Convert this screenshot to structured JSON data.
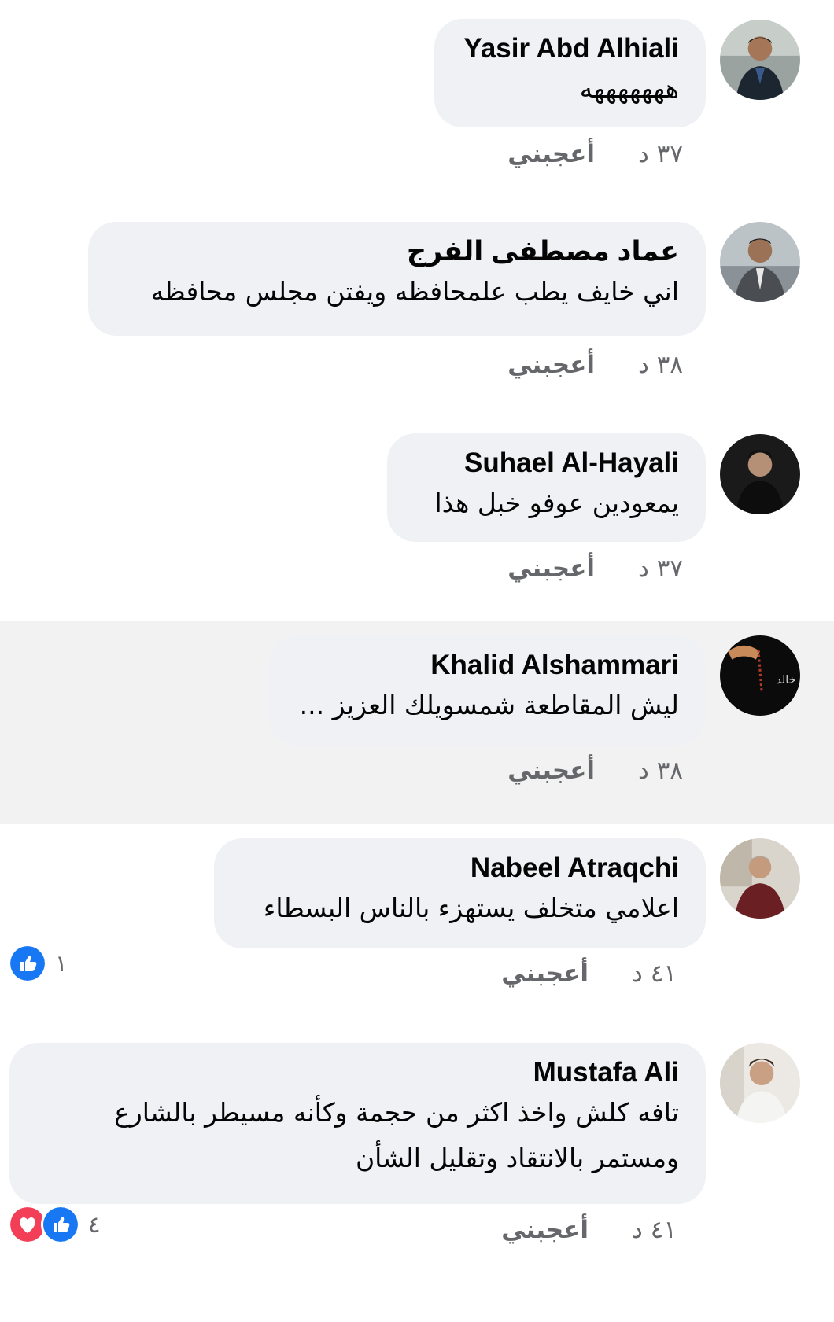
{
  "comments": [
    {
      "name": "Yasir Abd Alhiali",
      "text": "هههههههه",
      "time": "٣٧ د",
      "like": "أعجبني"
    },
    {
      "name": "عماد مصطفى الفرج",
      "text": "اني خايف يطب علمحافظه ويفتن مجلس محافظه",
      "time": "٣٨ د",
      "like": "أعجبني"
    },
    {
      "name": "Suhael Al-Hayali",
      "text": "يمعودين عوفو خبل هذا",
      "time": "٣٧ د",
      "like": "أعجبني"
    },
    {
      "name": "Khalid Alshammari",
      "text": "ليش المقاطعة شمسويلك العزيز ...",
      "time": "٣٨ د",
      "like": "أعجبني"
    },
    {
      "name": "Nabeel Atraqchi",
      "text": "اعلامي متخلف يستهزء بالناس البسطاء",
      "time": "٤١ د",
      "like": "أعجبني",
      "reaction_count": "١",
      "reactions": [
        "like-icon"
      ]
    },
    {
      "name": "Mustafa Ali",
      "text_line1": "تافه كلش واخذ اكثر من حجمة وكأنه مسيطر بالشارع",
      "text_line2": "ومستمر بالانتقاد وتقليل الشأن",
      "time": "٤١ د",
      "like": "أعجبني",
      "reaction_count": "٤",
      "reactions": [
        "love-icon",
        "like-icon"
      ]
    }
  ],
  "colors": {
    "bubble": "#eff1f4",
    "meta": "#65676b",
    "highlight": "#f2f2f2",
    "like_blue": "#1877f2",
    "love_red": "#f33e58"
  }
}
